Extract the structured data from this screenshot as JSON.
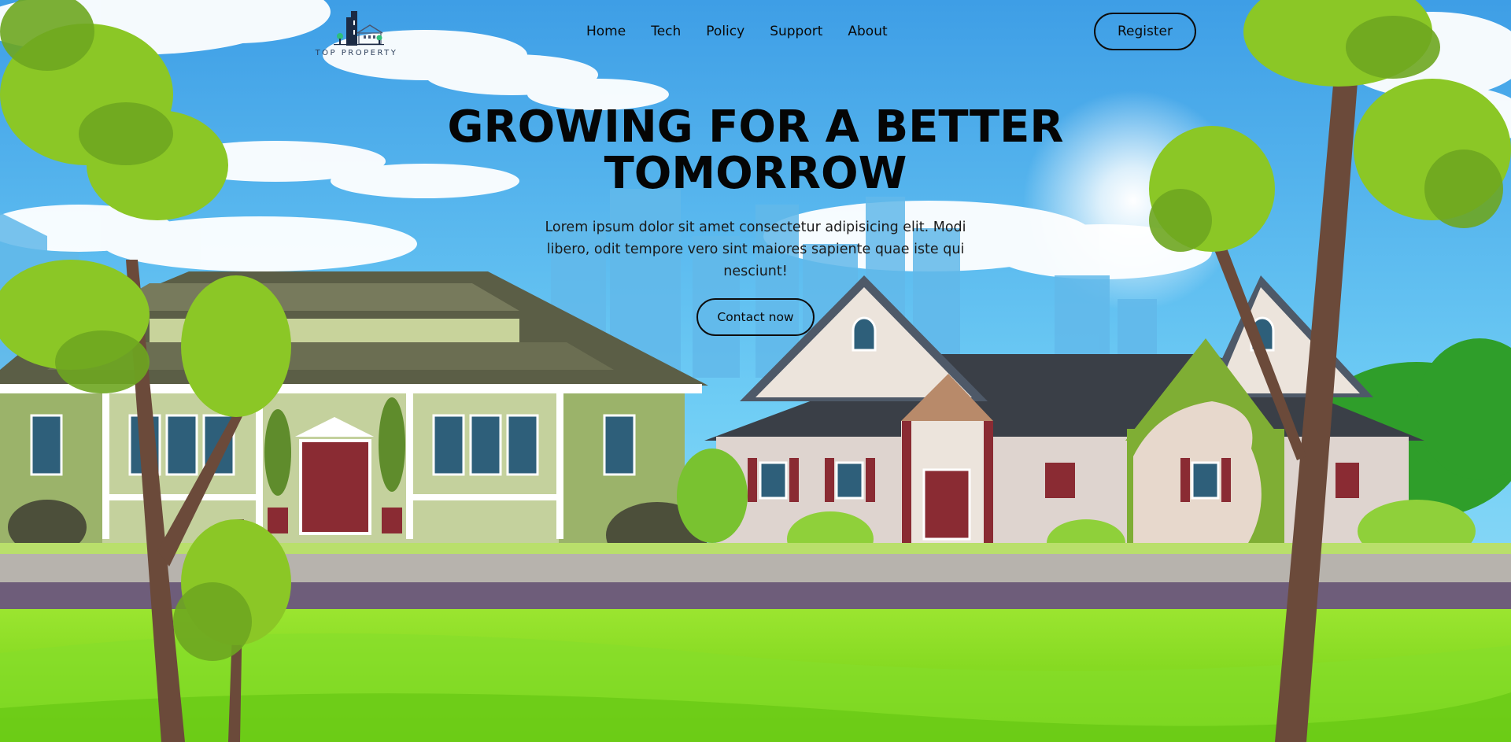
{
  "brand": {
    "name": "TOP PROPERTY",
    "logo_icon": "house-building-logo-icon"
  },
  "nav": {
    "items": [
      {
        "label": "Home"
      },
      {
        "label": "Tech"
      },
      {
        "label": "Policy"
      },
      {
        "label": "Support"
      },
      {
        "label": "About"
      }
    ],
    "register_label": "Register"
  },
  "hero": {
    "title_line1": "GROWING FOR A BETTER",
    "title_line2": "TOMORROW",
    "description": "Lorem ipsum dolor sit amet consectetur adipisicing elit. Modi libero, odit tempore vero sint maiores sapiente quae iste qui nesciunt!",
    "cta_label": "Contact now"
  },
  "colors": {
    "sky_top": "#4aa6e8",
    "sky_bottom": "#7fd8f7",
    "grass": "#8fe024",
    "road": "#6e5d7a",
    "text": "#050505"
  }
}
